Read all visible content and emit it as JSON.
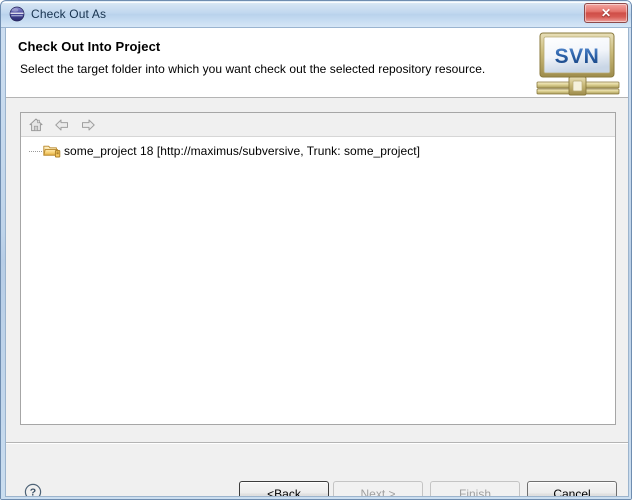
{
  "window": {
    "title": "Check Out As",
    "title_icon": "eclipse-globe-icon",
    "close_label": "✕"
  },
  "header": {
    "title": "Check Out Into Project",
    "description": "Select the target folder into which you want check out the selected repository resource.",
    "logo_text": "SVN",
    "logo_name": "svn-banner-logo"
  },
  "tree_panel": {
    "toolbar": {
      "home_icon": "home-icon",
      "back_icon": "arrow-left-icon",
      "forward_icon": "arrow-right-icon"
    },
    "items": [
      {
        "icon": "repository-folder-icon",
        "label": "some_project 18 [http://maximus/subversive, Trunk: some_project]"
      }
    ]
  },
  "footer": {
    "help_icon": "help-question-icon",
    "buttons": [
      {
        "prefix": "< ",
        "mnemonic": "B",
        "suffix": "ack",
        "state": "default"
      },
      {
        "prefix": "",
        "mnemonic": "N",
        "suffix": "ext >",
        "state": "disabled"
      },
      {
        "prefix": "",
        "mnemonic": "F",
        "suffix": "inish",
        "state": "disabled"
      },
      {
        "prefix": "",
        "mnemonic": "",
        "suffix": "Cancel",
        "state": "enabled"
      }
    ]
  },
  "colors": {
    "titlebar": "#c2d8ef",
    "close_red": "#cf4e48",
    "header_bg": "#ffffff",
    "client_bg": "#f0f0f0",
    "svn_blue": "#2a5fa5"
  }
}
